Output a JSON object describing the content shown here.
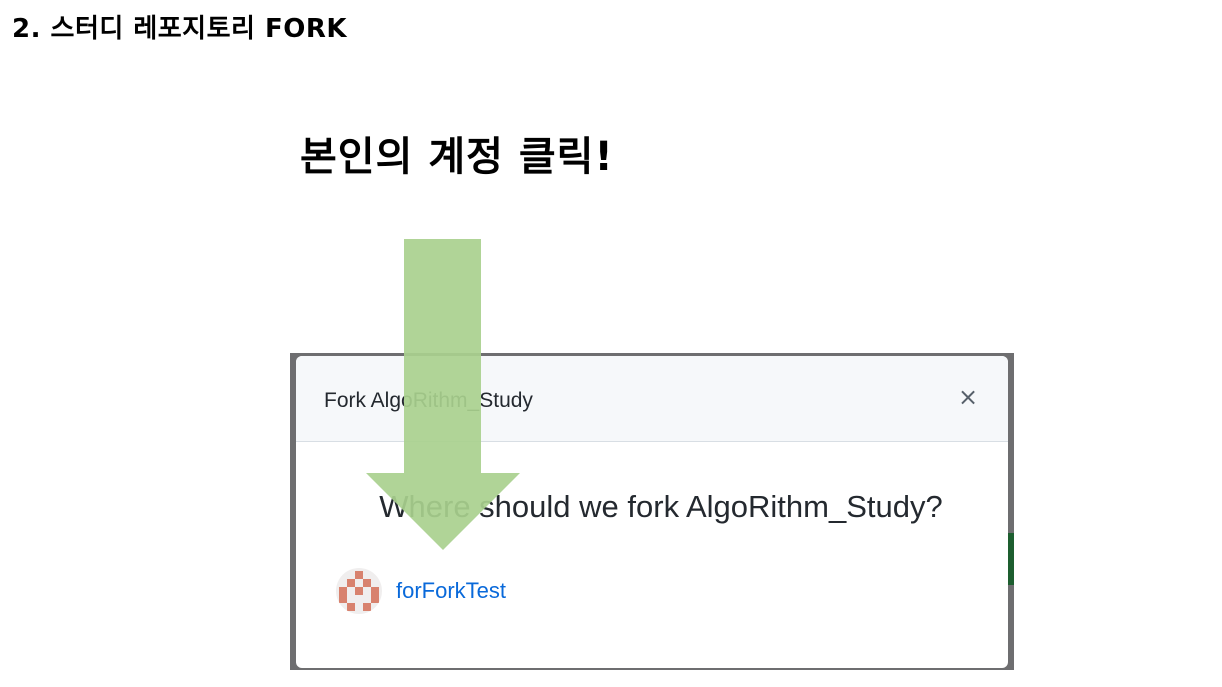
{
  "page": {
    "section_title": "2. 스터디 레포지토리 FORK",
    "instruction": "본인의 계정 클릭!"
  },
  "dialog": {
    "title": "Fork AlgoRithm_Study",
    "close_label": "×",
    "question": "Where should we fork AlgoRithm_Study?",
    "account": {
      "name": "forForkTest",
      "avatar_icon": "identicon-avatar"
    }
  },
  "colors": {
    "arrow": "#a9d08e",
    "link": "#0969da",
    "avatar": "#d8826e",
    "header_bg": "#f6f8fa"
  }
}
